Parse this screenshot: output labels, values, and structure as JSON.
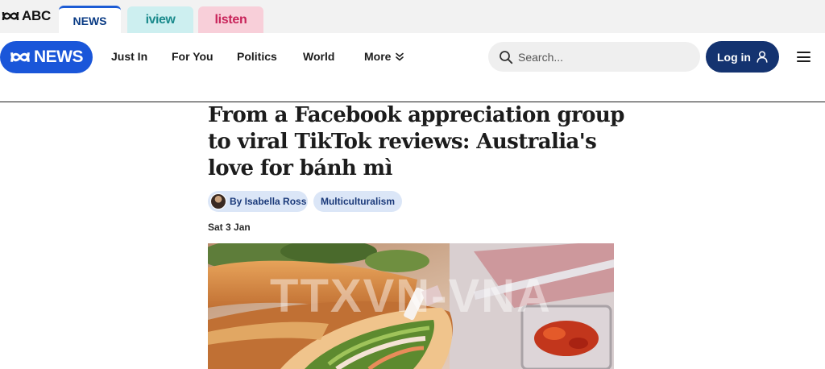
{
  "brand": {
    "abc_logo_text": "ABC",
    "news_logo_text": "NEWS"
  },
  "site_tabs": [
    {
      "label": "NEWS",
      "color": "#0a3b84"
    },
    {
      "label": "iview",
      "color": "#1a8a8c"
    },
    {
      "label": "listen",
      "color": "#c8245a"
    }
  ],
  "nav": {
    "items": [
      "Just In",
      "For You",
      "Politics",
      "World"
    ],
    "more_label": "More"
  },
  "search": {
    "placeholder": "Search..."
  },
  "login": {
    "label": "Log in"
  },
  "article": {
    "headline": "From a Facebook appreciation group to viral TikTok reviews: Australia's love for bánh mì",
    "author": "By Isabella Ross",
    "topic": "Multiculturalism",
    "date": "Sat 3 Jan",
    "watermark": "TTXVN-VNA"
  },
  "colors": {
    "accent": "#1a56d9",
    "login_bg": "#143370",
    "pill_bg": "#dbe6f7"
  }
}
